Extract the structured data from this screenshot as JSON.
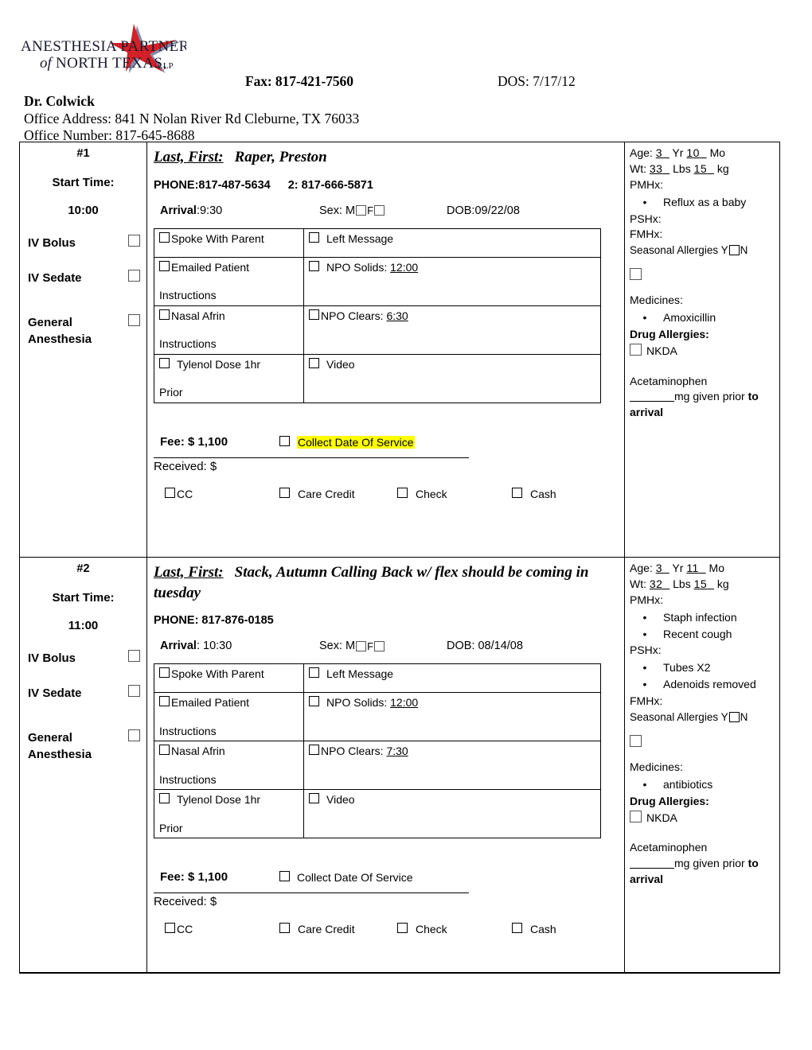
{
  "header": {
    "logo_line1": "ANESTHESIA PARTNERS",
    "logo_line2_pre": "of",
    "logo_line2": "NORTH TEXAS,",
    "logo_suffix": "LLP",
    "fax": "Fax: 817-421-7560",
    "dos": "DOS: 7/17/12",
    "doctor": "Dr. Colwick",
    "office_address": "Office Address:  841 N Nolan River Rd Cleburne, TX  76033",
    "office_number": "Office Number: 817-645-8688"
  },
  "labels": {
    "start_time": "Start Time:",
    "iv_bolus": "IV Bolus",
    "iv_sedate": "IV Sedate",
    "general_anesthesia": "General Anesthesia",
    "last_first": "Last, First:",
    "arrival": "Arrival",
    "sex": "Sex: M",
    "sex_f": "F",
    "dob_prefix": "DOB:",
    "spoke_with_parent": "Spoke With Parent",
    "left_message": "Left Message",
    "emailed_patient": "Emailed Patient",
    "npo_solids": "NPO Solids:",
    "instructions": "Instructions",
    "nasal_afrin": "Nasal Afrin",
    "npo_clears": "NPO Clears:",
    "tylenol": "Tylenol Dose 1hr",
    "prior": "Prior",
    "video": "Video",
    "fee": "Fee: $ 1,100",
    "collect_dos": "Collect Date Of Service",
    "received": "Received: $",
    "cc": "CC",
    "care_credit": "Care Credit",
    "check": "Check",
    "cash": "Cash",
    "age": "Age:",
    "yr": "Yr",
    "mo": "Mo",
    "wt": "Wt:",
    "lbs": "Lbs",
    "kg": "kg",
    "pmhx": "PMHx:",
    "pshx": "PSHx:",
    "fmhx": "FMHx:",
    "seasonal_allergies": "Seasonal Allergies Y",
    "seasonal_n": "N",
    "medicines": "Medicines:",
    "drug_allergies": "Drug Allergies:",
    "nkda": "NKDA",
    "acetaminophen": "Acetaminophen",
    "mg_given": "mg   given prior",
    "to": "to",
    "arrival_word": "arrival"
  },
  "colors": {
    "highlight": "#ffff00",
    "logo_star": "#d42027",
    "logo_star_shadow": "#7f8caa",
    "border": "#000000"
  },
  "patients": [
    {
      "seq": "#1",
      "start_time": "10:00",
      "name": "Raper, Preston",
      "phone1": "PHONE:817-487-5634",
      "phone2": "2: 817-666-5871",
      "arrival_time": "9:30",
      "dob": "09/22/08",
      "npo_solids": "12:00",
      "npo_clears": "6:30",
      "fee": "Fee: $ 1,100",
      "collect_highlighted": true,
      "age_yr": "3",
      "age_mo": "10",
      "wt_lbs": "33",
      "wt_kg": "15",
      "pmhx": [
        "Reflux as a baby"
      ],
      "pshx": [],
      "fmhx": [],
      "medicines": [
        "Amoxicillin"
      ]
    },
    {
      "seq": "#2",
      "start_time": "11:00",
      "name": "Stack, Autumn Calling Back w/ flex should be coming in tuesday",
      "phone1": "PHONE: 817-876-0185",
      "phone2": "",
      "arrival_time": "10:30",
      "dob": "08/14/08",
      "npo_solids": "12:00",
      "npo_clears": "7:30",
      "fee": "Fee: $ 1,100",
      "collect_highlighted": false,
      "age_yr": "3",
      "age_mo": "11",
      "wt_lbs": "32",
      "wt_kg": "15",
      "pmhx": [
        "Staph infection",
        "Recent cough"
      ],
      "pshx": [
        "Tubes X2",
        "Adenoids removed"
      ],
      "fmhx": [],
      "medicines": [
        "antibiotics"
      ]
    }
  ]
}
